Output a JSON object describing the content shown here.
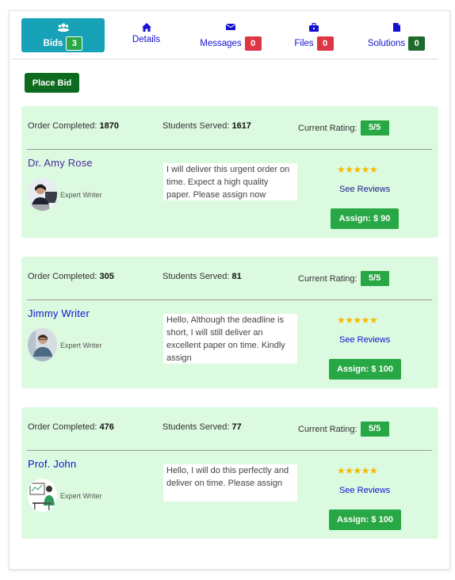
{
  "tabs": [
    {
      "label": "Bids",
      "badge": "3",
      "icon": "users-icon"
    },
    {
      "label": "Details",
      "icon": "home-icon"
    },
    {
      "label": "Messages",
      "badge": "0",
      "icon": "envelope-icon"
    },
    {
      "label": "Files",
      "badge": "0",
      "icon": "briefcase-icon"
    },
    {
      "label": "Solutions",
      "badge": "0",
      "icon": "file-icon"
    }
  ],
  "place_bid_label": "Place Bid",
  "labels": {
    "order_completed": "Order Completed:",
    "students_served": "Students Served:",
    "current_rating": "Current Rating:",
    "role": "Expert Writer",
    "see_reviews": "See Reviews",
    "stars": "★★★★★"
  },
  "bids": [
    {
      "orders": "1870",
      "students": "1617",
      "rating": "5/5",
      "name": "Dr. Amy Rose",
      "message": "I will deliver this urgent order on time. Expect a high quality paper. Please assign now",
      "assign": "Assign: $ 90"
    },
    {
      "orders": "305",
      "students": "81",
      "rating": "5/5",
      "name": "Jimmy Writer",
      "message": "Hello, Although the deadline is short, I will still deliver an excellent paper on time. Kindly assign",
      "assign": "Assign: $ 100"
    },
    {
      "orders": "476",
      "students": "77",
      "rating": "5/5",
      "name": "Prof. John",
      "message": "Hello, I will do this perfectly and deliver on time. Please assign",
      "assign": "Assign: $ 100"
    }
  ],
  "colors": {
    "tab_active": "#17a2b8",
    "card_bg": "#dcfae0",
    "accent_green": "#28a745",
    "badge_red": "#dc3545",
    "link_blue": "#1411d1"
  }
}
